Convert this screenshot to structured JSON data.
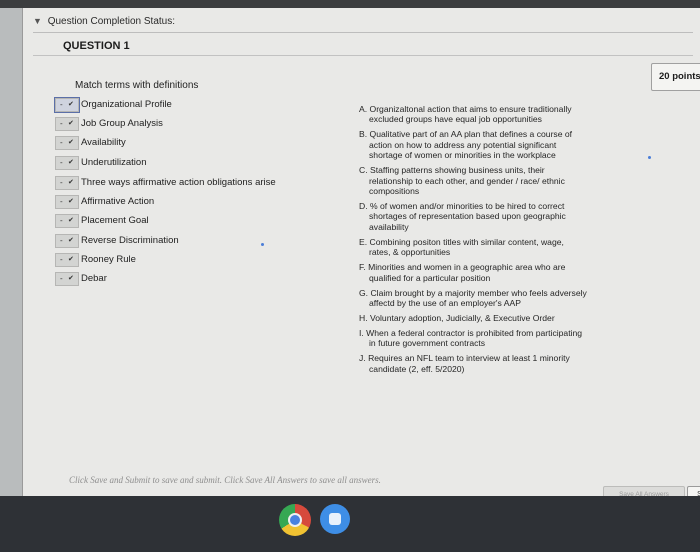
{
  "status_bar": {
    "toggle_icon": "collapse-arrow-icon",
    "label": "Question Completion Status:"
  },
  "question": {
    "title": "QUESTION 1",
    "points": "20 points"
  },
  "instructions": "Match terms with definitions",
  "terms": [
    {
      "label": "Organizational Profile",
      "selected": "-"
    },
    {
      "label": "Job Group Analysis",
      "selected": "-"
    },
    {
      "label": "Availability",
      "selected": "-"
    },
    {
      "label": "Underutilization",
      "selected": "-"
    },
    {
      "label": "Three ways affirmative action obligations arise",
      "selected": "-"
    },
    {
      "label": "Affirmative Action",
      "selected": "-"
    },
    {
      "label": "Placement Goal",
      "selected": "-"
    },
    {
      "label": "Reverse Discrimination",
      "selected": "-"
    },
    {
      "label": "Rooney Rule",
      "selected": "-"
    },
    {
      "label": "Debar",
      "selected": "-"
    }
  ],
  "definitions": [
    {
      "line1": "A. Organizaltonal action that aims to ensure traditionally",
      "line2": "excluded groups have equal job opportunities"
    },
    {
      "line1": "B. Qualitative part of an AA plan that defines a course of",
      "line2": "action on how to address any potential significant",
      "line3": "shortage of women or minorities in the workplace"
    },
    {
      "line1": "C. Staffing patterns showing business units, their",
      "line2": "relationship to each other, and gender / race/ ethnic",
      "line3": "compositions"
    },
    {
      "line1": "D. % of women and/or minorities to be hired to correct",
      "line2": "shortages of representation based upon geographic",
      "line3": "availability"
    },
    {
      "line1": "E. Combining positon titles with similar content, wage,",
      "line2": "rates, & opportunities"
    },
    {
      "line1": "F. Minorities and women in a geographic area who are",
      "line2": "qualified for a particular position"
    },
    {
      "line1": "G. Claim brought by a majority member who feels adversely",
      "line2": "affectd by the use of an employer's AAP"
    },
    {
      "line1": "H. Voluntary adoption, Judicially, & Executive Order"
    },
    {
      "line1": "I. When a federal contractor is prohibited from participating",
      "line2": "in future government contracts"
    },
    {
      "line1": "J. Requires an NFL team to interview at least 1 minority",
      "line2": "candidate (2, eff. 5/2020)"
    }
  ],
  "footer": {
    "hint": "Click Save and Submit to save and submit. Click Save All Answers to save all answers.",
    "save_all_label": "Save All Answers",
    "save_submit_label": "Save a"
  },
  "taskbar": {
    "icons": [
      "chrome-icon",
      "app-icon"
    ]
  },
  "colors": {
    "panel_bg": "#e9e9e7",
    "backdrop": "#b9bcbd",
    "taskbar": "#2e3136",
    "select_highlight": "#5b6fa8"
  }
}
